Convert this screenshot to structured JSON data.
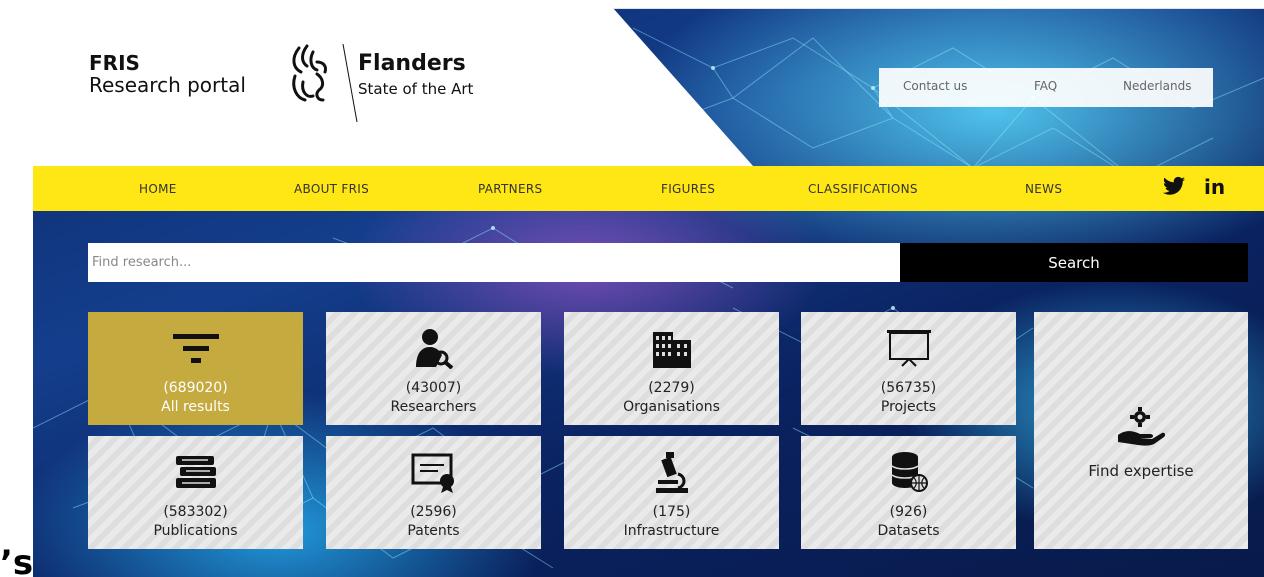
{
  "header": {
    "fris_line1": "FRIS",
    "fris_line2": "Research portal",
    "flanders_title": "Flanders",
    "flanders_subtitle": "State of the Art",
    "links": {
      "contact": "Contact us",
      "faq": "FAQ",
      "language": "Nederlands"
    }
  },
  "nav": {
    "home": "HOME",
    "about": "ABOUT FRIS",
    "partners": "PARTNERS",
    "figures": "FIGURES",
    "classifications": "CLASSIFICATIONS",
    "news": "NEWS",
    "twitter_icon": "twitter-icon",
    "linkedin_icon": "linkedin-icon",
    "linkedin_glyph": "in"
  },
  "search": {
    "placeholder": "Find research...",
    "button": "Search"
  },
  "tiles": {
    "all": {
      "count": "(689020)",
      "label": "All results",
      "icon": "filter-icon"
    },
    "researchers": {
      "count": "(43007)",
      "label": "Researchers",
      "icon": "researcher-icon"
    },
    "organisations": {
      "count": "(2279)",
      "label": "Organisations",
      "icon": "building-icon"
    },
    "projects": {
      "count": "(56735)",
      "label": "Projects",
      "icon": "presentation-icon"
    },
    "publications": {
      "count": "(583302)",
      "label": "Publications",
      "icon": "books-icon"
    },
    "patents": {
      "count": "(2596)",
      "label": "Patents",
      "icon": "certificate-icon"
    },
    "infrastructure": {
      "count": "(175)",
      "label": "Infrastructure",
      "icon": "microscope-icon"
    },
    "datasets": {
      "count": "(926)",
      "label": "Datasets",
      "icon": "database-icon"
    },
    "expertise": {
      "label": "Find expertise",
      "icon": "hand-gear-icon"
    }
  },
  "colors": {
    "nav_yellow": "#ffe615",
    "active_tile": "#c4aa3f",
    "tile_grey": "#dedede",
    "search_button": "#000000"
  },
  "stray": "’s"
}
